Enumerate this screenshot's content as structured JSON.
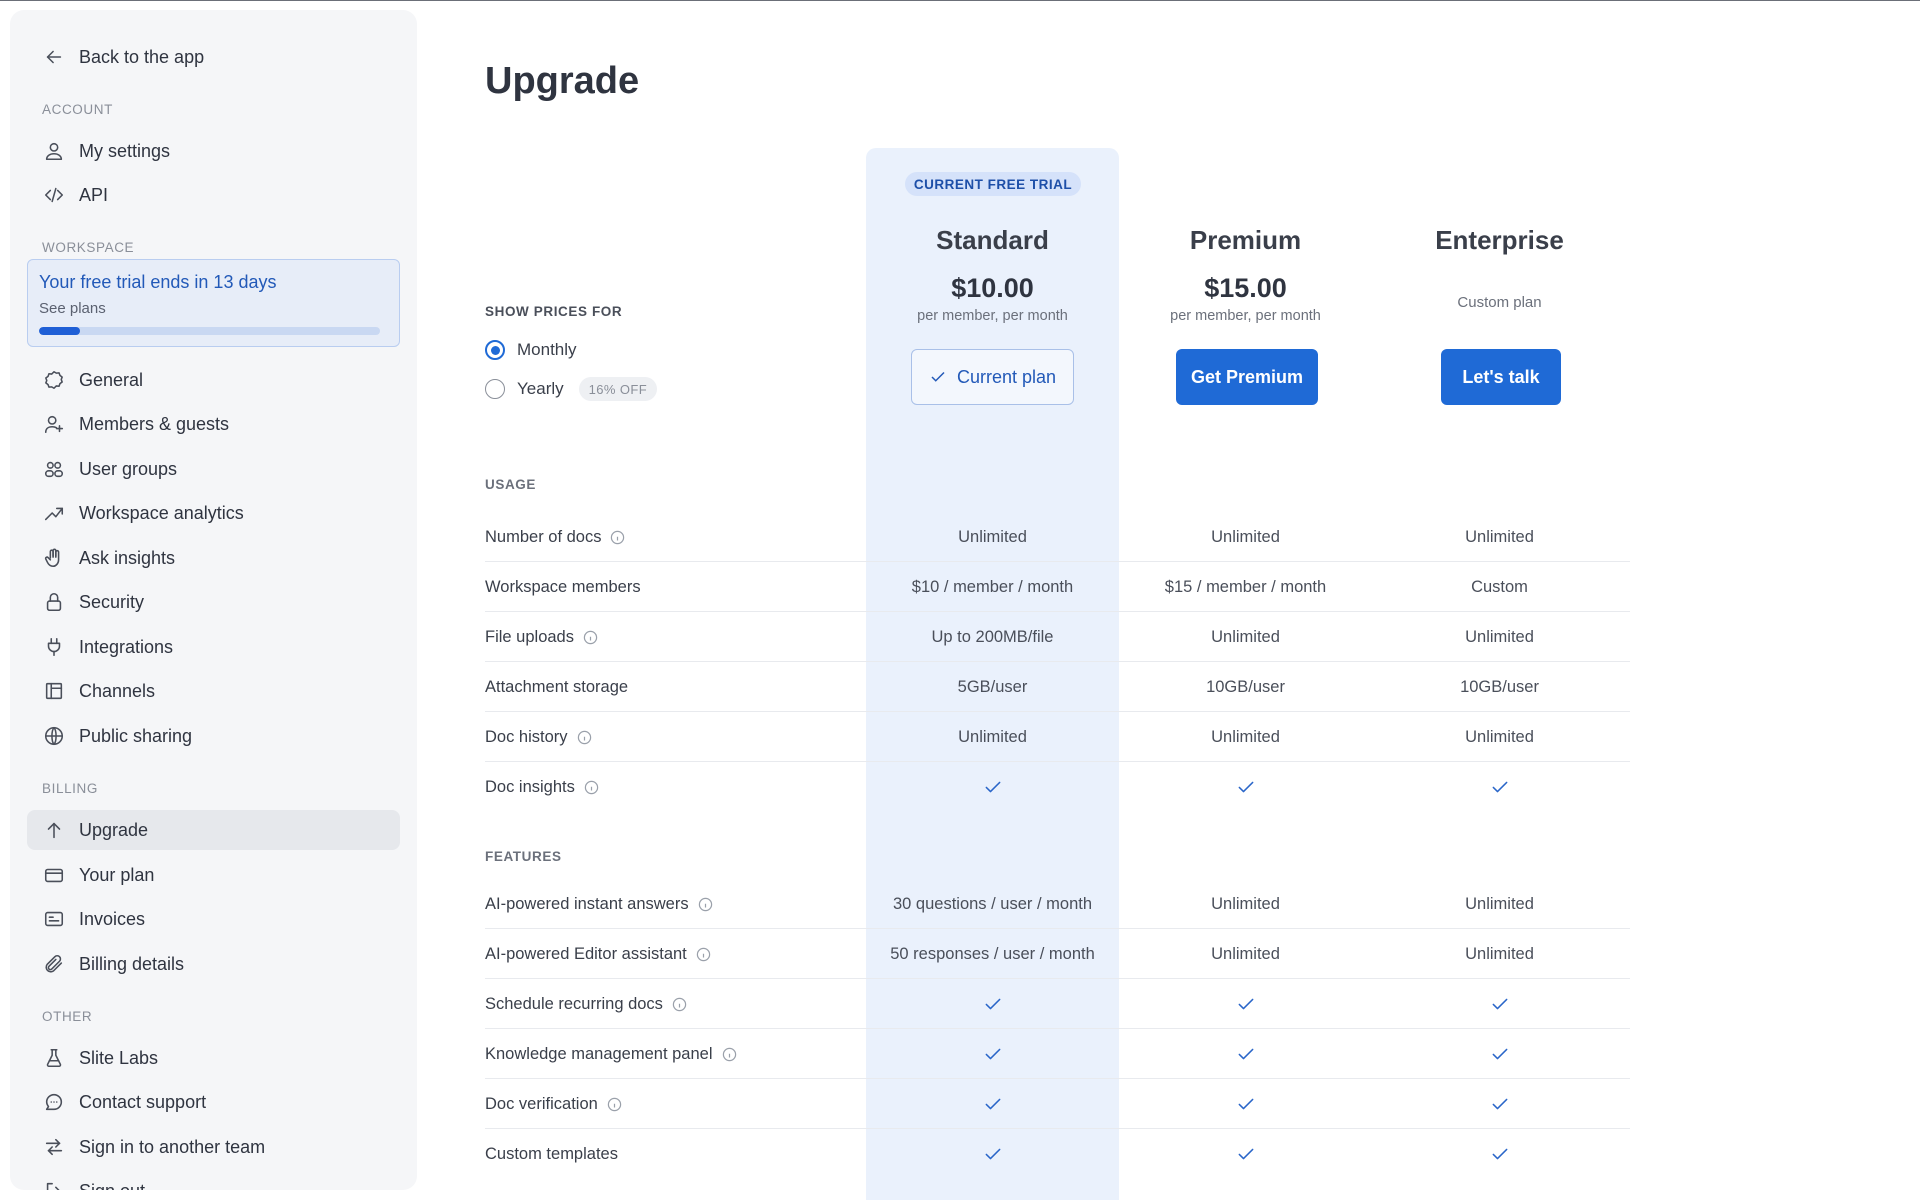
{
  "sidebar": {
    "back": "Back to the app",
    "sections": {
      "account": "ACCOUNT",
      "workspace": "WORKSPACE",
      "billing": "BILLING",
      "other": "OTHER"
    },
    "account_items": [
      "My settings",
      "API"
    ],
    "trial": {
      "title": "Your free trial ends in 13 days",
      "link": "See plans",
      "progress": 0.12
    },
    "workspace_items": [
      "General",
      "Members & guests",
      "User groups",
      "Workspace analytics",
      "Ask insights",
      "Security",
      "Integrations",
      "Channels",
      "Public sharing"
    ],
    "billing_items": [
      "Upgrade",
      "Your plan",
      "Invoices",
      "Billing details"
    ],
    "other_items": [
      "Slite Labs",
      "Contact support",
      "Sign in to another team",
      "Sign out"
    ]
  },
  "main": {
    "title": "Upgrade",
    "show_prices_label": "SHOW PRICES FOR",
    "options": {
      "monthly": "Monthly",
      "yearly": "Yearly",
      "discount": "16% OFF"
    },
    "badge": "CURRENT FREE TRIAL",
    "plans": [
      {
        "name": "Standard",
        "price": "$10.00",
        "sub": "per member, per month",
        "button": "Current plan"
      },
      {
        "name": "Premium",
        "price": "$15.00",
        "sub": "per member, per month",
        "button": "Get Premium"
      },
      {
        "name": "Enterprise",
        "custom": "Custom plan",
        "button": "Let's talk"
      }
    ],
    "usage_label": "USAGE",
    "usage_rows": [
      {
        "label": "Number of docs",
        "values": [
          "Unlimited",
          "Unlimited",
          "Unlimited"
        ]
      },
      {
        "label": "Workspace members",
        "values": [
          "$10 / member / month",
          "$15 / member / month",
          "Custom"
        ]
      },
      {
        "label": "File uploads",
        "values": [
          "Up to 200MB/file",
          "Unlimited",
          "Unlimited"
        ]
      },
      {
        "label": "Attachment storage",
        "values": [
          "5GB/user",
          "10GB/user",
          "10GB/user"
        ]
      },
      {
        "label": "Doc history",
        "values": [
          "Unlimited",
          "Unlimited",
          "Unlimited"
        ]
      },
      {
        "label": "Doc insights",
        "values": [
          "",
          "",
          ""
        ]
      }
    ],
    "features_label": "FEATURES",
    "feature_rows": [
      {
        "label": "AI-powered instant answers",
        "values": [
          "30 questions / user / month",
          "Unlimited",
          "Unlimited"
        ]
      },
      {
        "label": "AI-powered Editor assistant",
        "values": [
          "50 responses / user / month",
          "Unlimited",
          "Unlimited"
        ]
      },
      {
        "label": "Schedule recurring docs",
        "values": [
          "",
          "",
          ""
        ]
      },
      {
        "label": "Knowledge management panel",
        "values": [
          "",
          "",
          ""
        ]
      },
      {
        "label": "Doc verification",
        "values": [
          "",
          "",
          ""
        ]
      },
      {
        "label": "Custom templates",
        "values": [
          "",
          "",
          ""
        ]
      }
    ]
  }
}
